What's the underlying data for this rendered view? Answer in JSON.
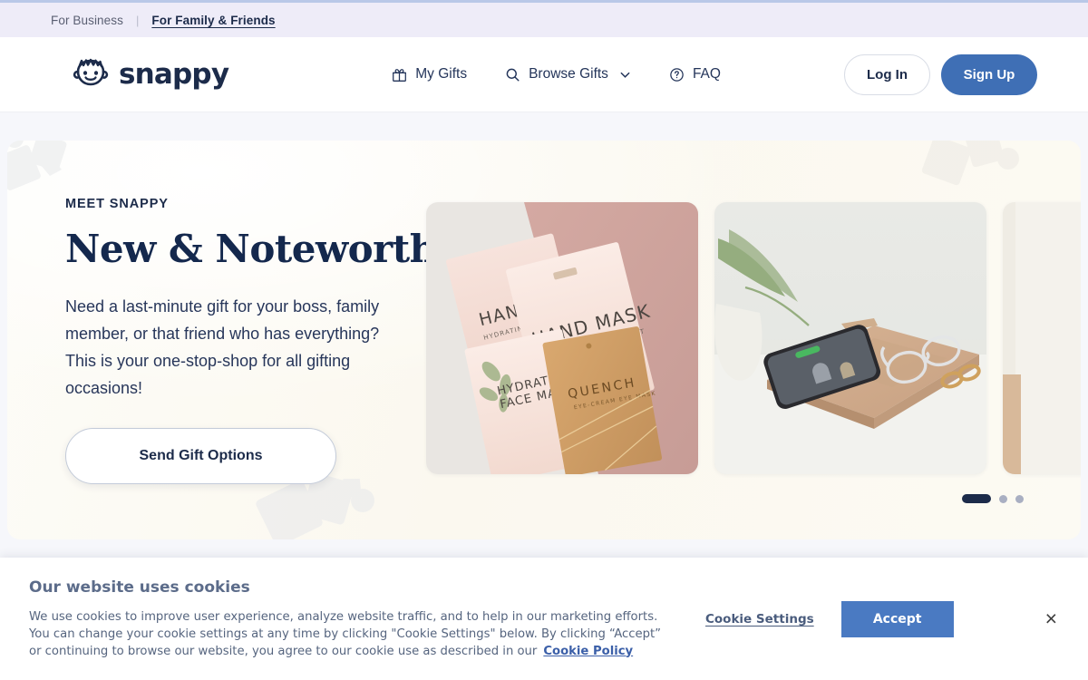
{
  "utility_bar": {
    "business_label": "For Business",
    "separator": "|",
    "family_label": "For Family & Friends"
  },
  "nav": {
    "logo_text": "snappy",
    "logo_icon": "snappy-face-icon",
    "links": [
      {
        "label": "My Gifts",
        "icon": "gift-icon"
      },
      {
        "label": "Browse Gifts",
        "icon": "search-icon",
        "caret": "chevron-down-icon"
      },
      {
        "label": "FAQ",
        "icon": "question-circle-icon"
      }
    ],
    "login_label": "Log In",
    "signup_label": "Sign Up",
    "signup_color": "#3f6fb5"
  },
  "hero": {
    "eyebrow": "MEET SNAPPY",
    "title": "New & Noteworthy",
    "copy": "Need a last-minute gift for your boss, family member, or that friend who has everything? This is your one-stop-shop for all gifting occasions!",
    "cta_label": "Send Gift Options",
    "background_color": "#fbf8ef",
    "title_color": "#14284d",
    "cards": [
      {
        "alt": "Skincare sheet mask packets on dusty rose background",
        "labels": [
          "HAND MASK",
          "HYDRATING FACE MASK",
          "QUENCH"
        ]
      },
      {
        "alt": "Wooden wireless charging tray with phone, glasses and rings",
        "labels": []
      },
      {
        "alt": "Partially visible third gift card",
        "labels": []
      }
    ],
    "carousel": {
      "active_index": 0,
      "total_dots": 3,
      "active_color": "#1c2b4a",
      "inactive_color": "#a9afc2"
    }
  },
  "cookie_banner": {
    "title": "Our website uses cookies",
    "body": "We use cookies to improve user experience, analyze website traffic, and to help in our marketing efforts. You can change your cookie settings at any time by clicking \"Cookie Settings\" below. By clicking “Accept” or continuing to browse our website, you agree to our cookie use as described in our",
    "policy_label": "Cookie Policy",
    "settings_label": "Cookie Settings",
    "accept_label": "Accept",
    "close_icon": "×",
    "accept_color": "#4a7ac2"
  }
}
